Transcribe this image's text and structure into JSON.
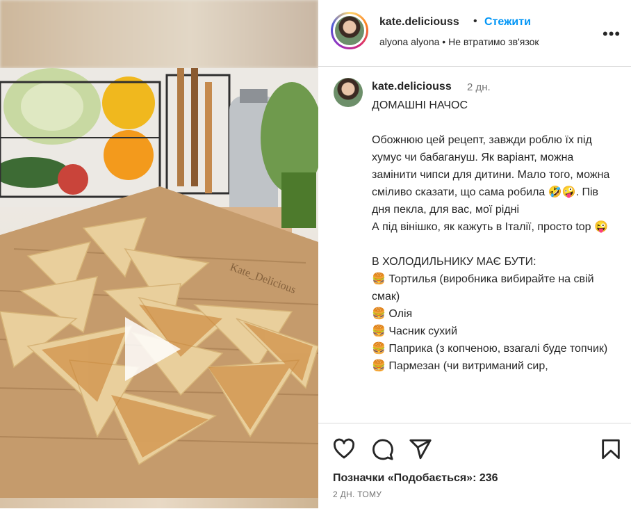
{
  "header": {
    "username": "kate.deliciouss",
    "separator": "•",
    "follow_label": "Стежити",
    "audio": "alyona alyona • Не втратимо зв'язок",
    "more_icon": "more-horizontal-icon",
    "more_glyph": "•••"
  },
  "caption": {
    "username": "kate.deliciouss",
    "time": "2 дн.",
    "text": "ДОМАШНІ НАЧОС\n\nОбожнюю цей рецепт, завжди роблю їх під хумус чи бабагануш. Як варіант, можна замінити чипси для дитини. Мало того, можна сміливо сказати, що сама робила 🤣🤪. Пів дня пекла, для вас, мої рідні\nА під вінішко, як кажуть в Італії, просто top 😜\n\nВ ХОЛОДИЛЬНИКУ МАЄ БУТИ:\n🍔 Тортилья (виробника вибирайте на свій смак)\n🍔 Олія\n🍔 Часник сухий\n🍔 Паприка (з копченою, взагалі буде топчик)\n🍔 Пармезан (чи витриманий сир,"
  },
  "media": {
    "overlay_text": "Kate_Delicious",
    "play_icon": "play-icon"
  },
  "actions": {
    "icons": [
      "heart-icon",
      "comment-icon",
      "share-icon",
      "bookmark-icon"
    ],
    "likes": "Позначки «Подобається»: 236",
    "date": "2 ДН. ТОМУ"
  }
}
